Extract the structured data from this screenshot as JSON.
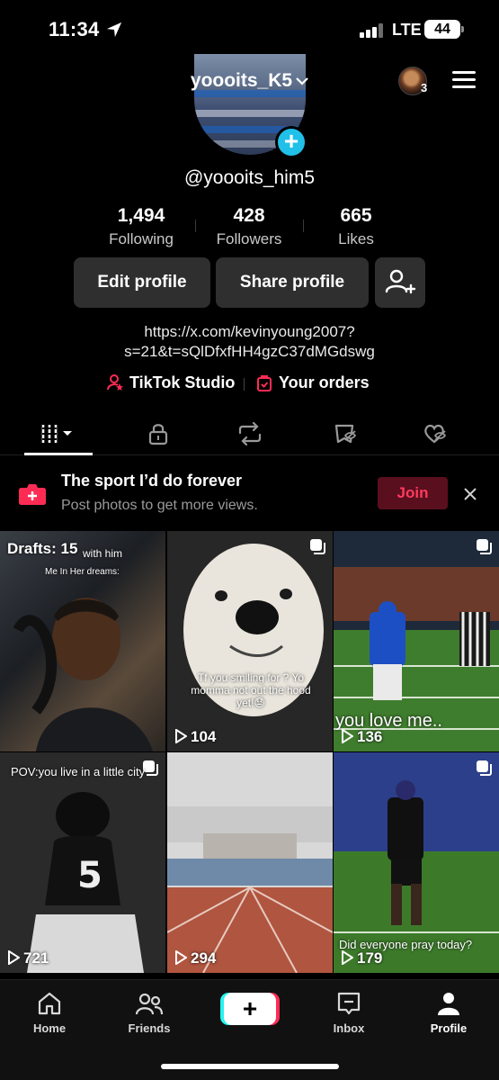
{
  "status": {
    "time": "11:34",
    "network": "LTE",
    "battery": "44"
  },
  "header": {
    "username": "yoooits_K5",
    "notification_count": "3"
  },
  "profile": {
    "handle": "@yoooits_him5",
    "stats": [
      {
        "value": "1,494",
        "label": "Following"
      },
      {
        "value": "428",
        "label": "Followers"
      },
      {
        "value": "665",
        "label": "Likes"
      }
    ],
    "buttons": {
      "edit": "Edit profile",
      "share": "Share profile"
    },
    "link_line1": "https://x.com/kevinyoung2007?",
    "link_line2": "s=21&t=sQlDfxfHH4gzC37dMGdswg",
    "studio": "TikTok Studio",
    "orders": "Your orders"
  },
  "tabs": [
    {
      "icon": "grid-icon",
      "active": true
    },
    {
      "icon": "lock-icon"
    },
    {
      "icon": "repost-icon"
    },
    {
      "icon": "bookmark-icon"
    },
    {
      "icon": "liked-icon"
    }
  ],
  "promo": {
    "title": "The sport I’d do forever",
    "subtitle": "Post photos to get more views.",
    "join": "Join"
  },
  "grid": {
    "drafts": "Drafts: 15",
    "tiles": [
      {
        "caption_top": "with him",
        "caption_mid": "Me In Her dreams:"
      },
      {
        "caption": "Tf you smiling for ? Yo momma not out the hood yet!😓",
        "views": "104"
      },
      {
        "caption": "you love me..",
        "views": "136"
      },
      {
        "caption": "POV:you live in a little city",
        "views": "721"
      },
      {
        "views": "294"
      },
      {
        "caption": "Did everyone pray today?",
        "views": "179"
      }
    ]
  },
  "nav": {
    "home": "Home",
    "friends": "Friends",
    "create": "+",
    "inbox": "Inbox",
    "profile": "Profile"
  },
  "colors": {
    "accent": "#fe2c55",
    "cyan": "#25f4ee",
    "background": "#000000"
  }
}
